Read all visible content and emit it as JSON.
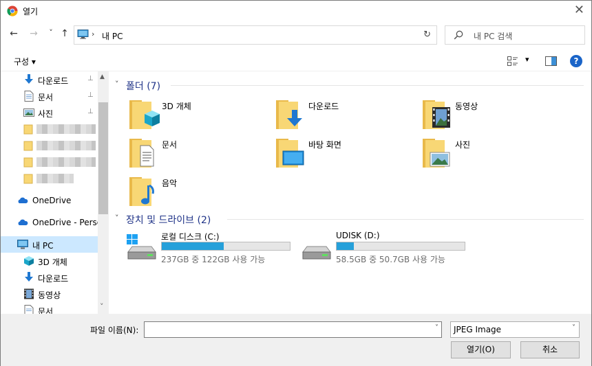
{
  "window": {
    "title": "열기",
    "close_glyph": "✕"
  },
  "nav": {
    "back_glyph": "←",
    "forward_glyph": "→",
    "recent_glyph": "˅",
    "up_glyph": "↑",
    "address_sep": "›",
    "address_text": "내 PC",
    "refresh_glyph": "↻",
    "search_placeholder": "내 PC 검색"
  },
  "toolbar": {
    "organize_label": "구성 ▾",
    "help_glyph": "?",
    "view_dd": "▾"
  },
  "tree": {
    "quick_access": [
      {
        "label": "다운로드",
        "icon": "download-icon",
        "pinned": true
      },
      {
        "label": "문서",
        "icon": "document-icon",
        "pinned": true
      },
      {
        "label": "사진",
        "icon": "pictures-icon",
        "pinned": true
      }
    ],
    "pin_glyph": "📌",
    "onedrive": "OneDrive",
    "onedrive_personal": "OneDrive - Personal",
    "this_pc": "내 PC",
    "pc_children": [
      {
        "label": "3D 개체",
        "icon": "3d-objects-icon"
      },
      {
        "label": "다운로드",
        "icon": "download-icon"
      },
      {
        "label": "동영상",
        "icon": "videos-icon"
      },
      {
        "label": "문서",
        "icon": "document-icon"
      }
    ],
    "scroll_up": "▲",
    "scroll_down": "˅"
  },
  "content": {
    "folders_header": "폴더 (7)",
    "folders": [
      {
        "name": "3D 개체",
        "icon": "3d-objects-icon"
      },
      {
        "name": "다운로드",
        "icon": "download-icon"
      },
      {
        "name": "동영상",
        "icon": "videos-icon"
      },
      {
        "name": "문서",
        "icon": "document-icon"
      },
      {
        "name": "바탕 화면",
        "icon": "desktop-icon"
      },
      {
        "name": "사진",
        "icon": "pictures-icon"
      },
      {
        "name": "음악",
        "icon": "music-icon"
      }
    ],
    "drives_header": "장치 및 드라이브 (2)",
    "drives": [
      {
        "name": "로컬 디스크 (C:)",
        "info": "237GB 중 122GB 사용 가능",
        "used_fraction": 0.485,
        "icon": "windows-drive-icon"
      },
      {
        "name": "UDISK (D:)",
        "info": "58.5GB 중 50.7GB 사용 가능",
        "used_fraction": 0.133,
        "icon": "drive-icon"
      }
    ],
    "chevron": "˅"
  },
  "footer": {
    "filename_label": "파일 이름(N):",
    "filename_value": "",
    "filetype_value": "JPEG Image",
    "open_label": "열기(O)",
    "cancel_label": "취소",
    "dropdown_glyph": "˅"
  },
  "colors": {
    "selection": "#cce8ff",
    "accent": "#26a0da",
    "group_header": "#1e3287",
    "folder": "#f8d775"
  }
}
